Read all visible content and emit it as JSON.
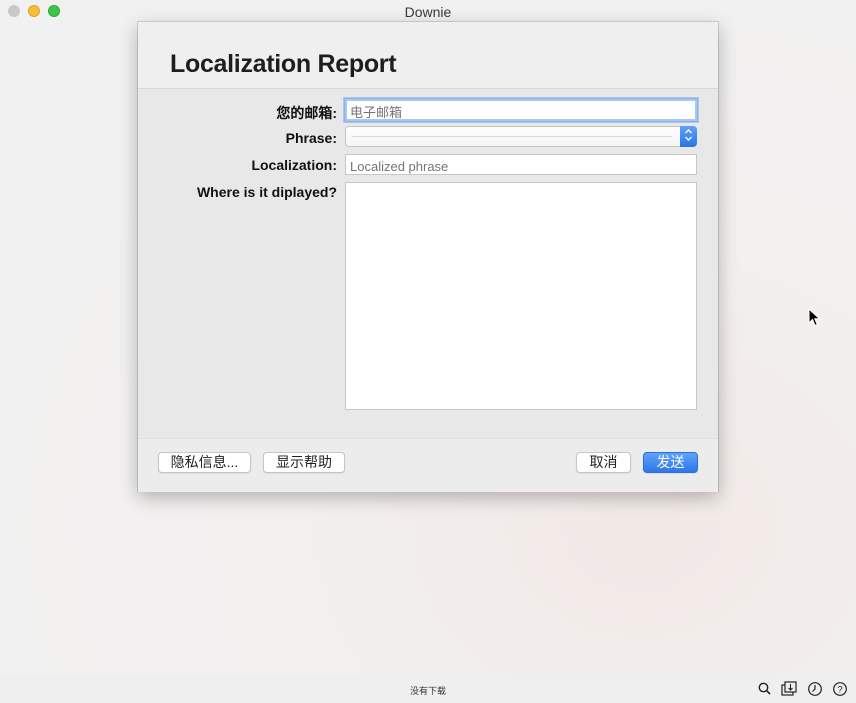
{
  "app": {
    "title": "Downie"
  },
  "sheet": {
    "title": "Localization Report",
    "fields": {
      "email": {
        "label": "您的邮箱:",
        "placeholder": "电子邮箱",
        "value": ""
      },
      "phrase": {
        "label": "Phrase:",
        "value": ""
      },
      "localization": {
        "label": "Localization:",
        "placeholder": "Localized phrase",
        "value": ""
      },
      "where": {
        "label": "Where is it diplayed?",
        "value": ""
      }
    },
    "buttons": {
      "privacy": "隐私信息...",
      "help": "显示帮助",
      "cancel": "取消",
      "send": "发送"
    }
  },
  "statusbar": {
    "text": "没有下载",
    "icons": [
      "search-icon",
      "downloads-icon",
      "history-icon",
      "help-icon"
    ]
  },
  "colors": {
    "accent": "#3b82f0",
    "focus_ring": "#a8c8ef"
  }
}
